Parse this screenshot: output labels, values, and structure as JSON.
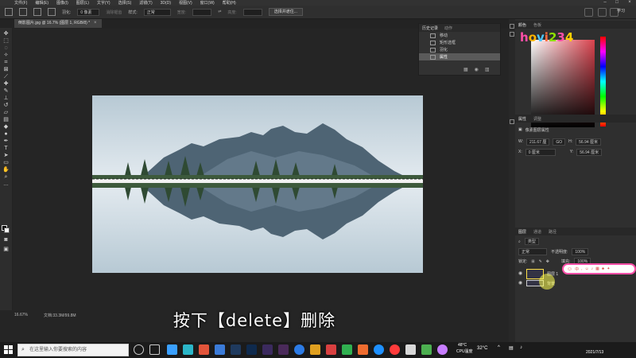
{
  "menubar": {
    "items": [
      "文件(F)",
      "编辑(E)",
      "图像(I)",
      "图层(L)",
      "文字(Y)",
      "选择(S)",
      "滤镜(T)",
      "3D(D)",
      "视图(V)",
      "窗口(W)",
      "帮助(H)"
    ]
  },
  "options": {
    "feather_label": "羽化:",
    "feather_value": "0 像素",
    "antialias_label": "消除锯齿",
    "style_label": "样式:",
    "style_value": "正常",
    "width_label": "宽度:",
    "height_label": "高度:",
    "select_mask_button": "选择并遮住...",
    "learn_label": "学习"
  },
  "document": {
    "tab_title": "倒影图片.jpg @ 16.7% (图层 1, RGB/8) *"
  },
  "history": {
    "tabs": [
      "历史记录",
      "动作"
    ],
    "items": [
      "移动",
      "矩形选框",
      "羽化",
      "属性"
    ]
  },
  "color_panel": {
    "tabs": [
      "颜色",
      "色板"
    ]
  },
  "logo": {
    "letters": [
      "h",
      "o",
      "v",
      "i",
      "2",
      "3",
      "4"
    ]
  },
  "properties": {
    "tabs": [
      "属性",
      "调整"
    ],
    "heading": "像素图层属性",
    "w_label": "W:",
    "w_value": "211.67 厘",
    "link_label": "GO",
    "h_label": "H:",
    "h_value": "56.94 厘米",
    "x_label": "X:",
    "x_value": "0 厘米",
    "y_label": "Y:",
    "y_value": "56.94 厘米"
  },
  "layers": {
    "tabs": [
      "图层",
      "通道",
      "路径"
    ],
    "filter_label": "类型",
    "blend_mode": "正常",
    "opacity_label": "不透明度:",
    "opacity_value": "100%",
    "lock_label": "锁定:",
    "fill_label": "填充:",
    "fill_value": "100%",
    "layer_1_name": "图层 1",
    "layer_2_name": "背景"
  },
  "ime": {
    "label": "中"
  },
  "status": {
    "zoom": "16.67%",
    "doc": "文档:33.3M/99.8M"
  },
  "subtitle": {
    "text": "按下【delete】删除"
  },
  "taskbar": {
    "search_placeholder": "在这里输入你要搜索的内容",
    "temperature": "32°C",
    "cpu_label": "CPU温度",
    "cpu_value": "48°C",
    "date": "2021/7/13"
  },
  "colors": {
    "accent_pink": "#ff4fa8",
    "panel_bg": "#2f2f2f"
  }
}
